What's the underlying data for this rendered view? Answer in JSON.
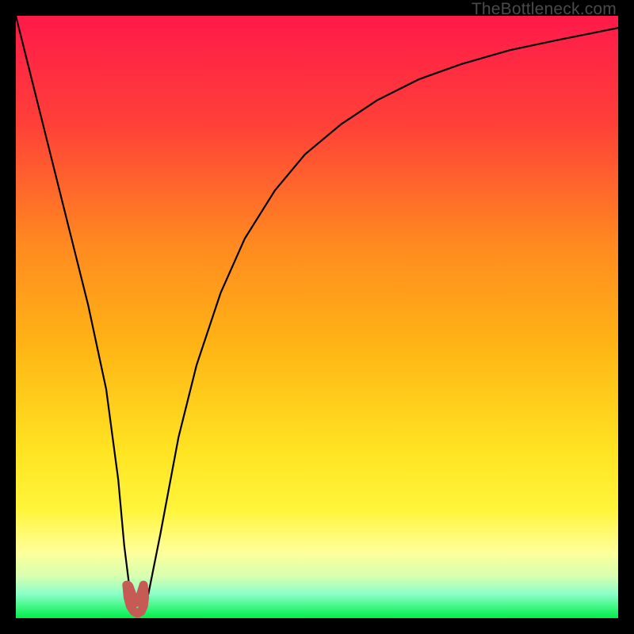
{
  "watermark": "TheBottleneck.com",
  "colors": {
    "top": "#ff1a4a",
    "upper_mid": "#ff6a2a",
    "mid": "#ffb515",
    "lower_mid": "#ffe322",
    "pale_yellow": "#ffff9a",
    "pale_green": "#9aff9a",
    "green": "#00ef4a",
    "curve": "#000000",
    "marker": "#c65a55"
  },
  "chart_data": {
    "type": "line",
    "title": "",
    "xlabel": "",
    "ylabel": "",
    "xlim": [
      0,
      100
    ],
    "ylim": [
      0,
      100
    ],
    "series": [
      {
        "name": "bottleneck-curve",
        "x": [
          0,
          3,
          6,
          9,
          12,
          15,
          17,
          18,
          19,
          20,
          21,
          22,
          24,
          27,
          30,
          34,
          38,
          43,
          48,
          54,
          60,
          67,
          74,
          82,
          90,
          100
        ],
        "y": [
          100,
          88,
          76,
          64,
          52,
          38,
          23,
          12,
          4,
          1,
          1,
          4,
          14,
          30,
          42,
          54,
          63,
          71,
          77,
          82,
          86,
          89.5,
          92,
          94.3,
          96,
          98
        ]
      },
      {
        "name": "minimum-marker",
        "x": [
          18.4,
          18.6,
          19.0,
          19.6,
          20.2,
          20.8,
          21.2,
          21.4,
          21.2,
          20.8,
          20.4,
          20.0,
          19.6,
          19.2,
          18.8,
          18.6,
          18.4
        ],
        "y": [
          5.5,
          3.5,
          2.0,
          1.1,
          0.8,
          1.1,
          2.0,
          3.5,
          5.5,
          4.2,
          3.0,
          2.6,
          3.0,
          4.2,
          5.3,
          5.5,
          5.5
        ]
      }
    ],
    "annotations": []
  }
}
